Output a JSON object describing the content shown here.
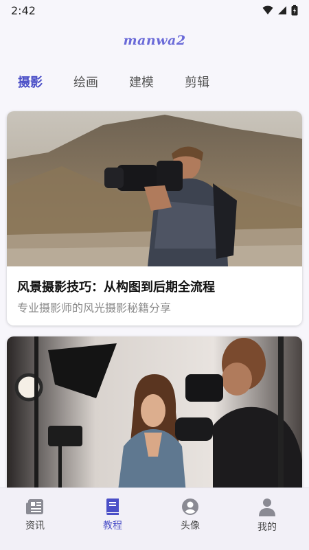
{
  "status": {
    "time": "2:42"
  },
  "app": {
    "title": "manwa2"
  },
  "tabs": [
    {
      "label": "摄影",
      "active": true
    },
    {
      "label": "绘画",
      "active": false
    },
    {
      "label": "建模",
      "active": false
    },
    {
      "label": "剪辑",
      "active": false
    }
  ],
  "cards": [
    {
      "title": "风景摄影技巧：从构图到后期全流程",
      "subtitle": "专业摄影师的风光摄影秘籍分享"
    },
    {
      "title": "",
      "subtitle": ""
    }
  ],
  "bottom_nav": [
    {
      "label": "资讯",
      "icon": "newspaper-icon",
      "active": false
    },
    {
      "label": "教程",
      "icon": "book-icon",
      "active": true
    },
    {
      "label": "头像",
      "icon": "avatar-circle-icon",
      "active": false
    },
    {
      "label": "我的",
      "icon": "person-icon",
      "active": false
    }
  ],
  "colors": {
    "accent": "#4b4fc7",
    "title": "#6a6ad8",
    "nav_bg": "#f2f0f7"
  }
}
